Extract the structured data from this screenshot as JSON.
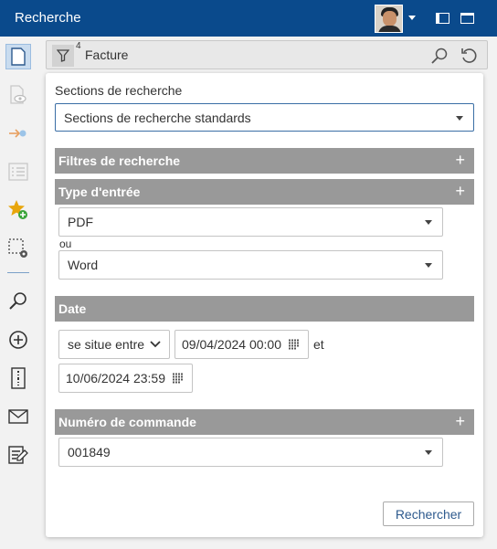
{
  "window": {
    "title": "Recherche"
  },
  "search": {
    "filter_count": "4",
    "query": "Facture"
  },
  "panel": {
    "section_label": "Sections de recherche",
    "section_value": "Sections de recherche standards",
    "filters_header": "Filtres de recherche",
    "input_type": {
      "header": "Type d'entrée",
      "first": "PDF",
      "or_label": "ou",
      "second": "Word"
    },
    "date": {
      "header": "Date",
      "operator": "se situe entre",
      "from": "09/04/2024 00:00",
      "and_label": "et",
      "to": "10/06/2024 23:59"
    },
    "order_number": {
      "header": "Numéro de commande",
      "value": "001849"
    },
    "search_button": "Rechercher",
    "plus_symbol": "+"
  },
  "colors": {
    "titlebar": "#0a4a8c",
    "section_header": "#999999",
    "accent_star": "#e8a60c",
    "accent_green": "#3aa53a",
    "link_blue": "#2e5a8e"
  }
}
